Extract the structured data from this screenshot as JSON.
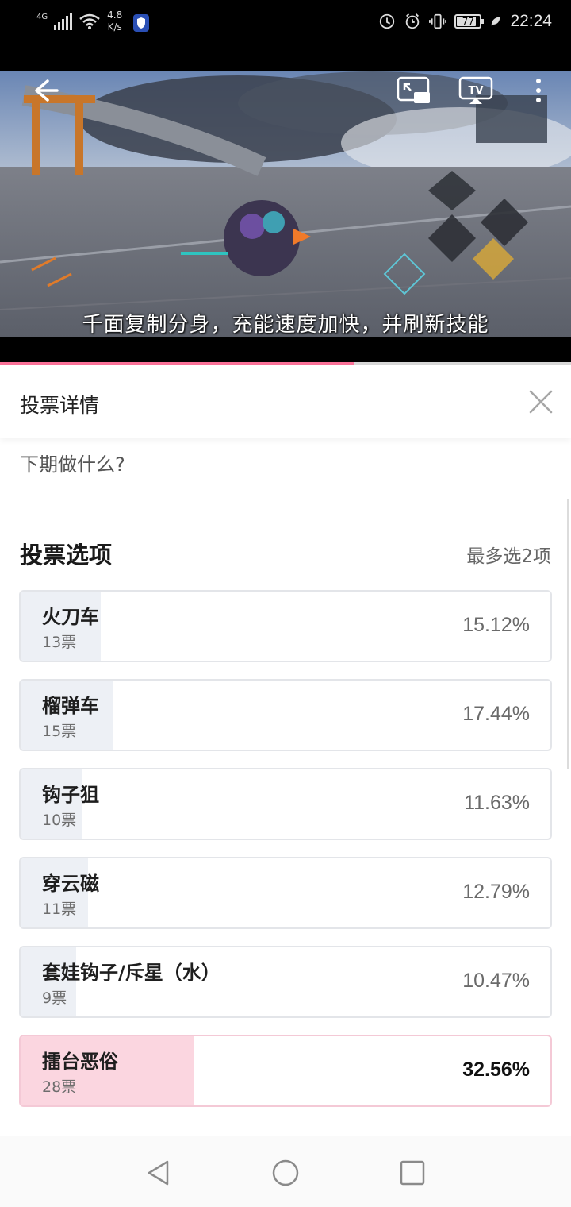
{
  "status_bar": {
    "network_type": "4G",
    "speed_value": "4.8",
    "speed_unit": "K/s",
    "battery_level": "77",
    "time": "22:24"
  },
  "video": {
    "subtitle": "千面复制分身，充能速度加快，并刷新技能",
    "progress_percent": 62,
    "icons": [
      "back-arrow-icon",
      "picture-in-picture-icon",
      "tv-cast-icon",
      "more-vertical-icon"
    ]
  },
  "panel": {
    "title": "投票详情",
    "question": "下期做什么?",
    "section_title": "投票选项",
    "limit_text": "最多选2项"
  },
  "options": [
    {
      "name": "火刀车",
      "votes": "13票",
      "percent": "15.12%",
      "fraction": 0.1512
    },
    {
      "name": "榴弹车",
      "votes": "15票",
      "percent": "17.44%",
      "fraction": 0.1744
    },
    {
      "name": "钩子狙",
      "votes": "10票",
      "percent": "11.63%",
      "fraction": 0.1163
    },
    {
      "name": "穿云磁",
      "votes": "11票",
      "percent": "12.79%",
      "fraction": 0.1279
    },
    {
      "name": "套娃钩子/斥星（水）",
      "votes": "9票",
      "percent": "10.47%",
      "fraction": 0.1047
    },
    {
      "name": "擂台恶俗",
      "votes": "28票",
      "percent": "32.56%",
      "fraction": 0.3256,
      "leading": true
    }
  ],
  "colors": {
    "accent_pink": "#fb7299",
    "winner_bar": "#fbd6e0",
    "option_bar": "#edf0f5"
  }
}
